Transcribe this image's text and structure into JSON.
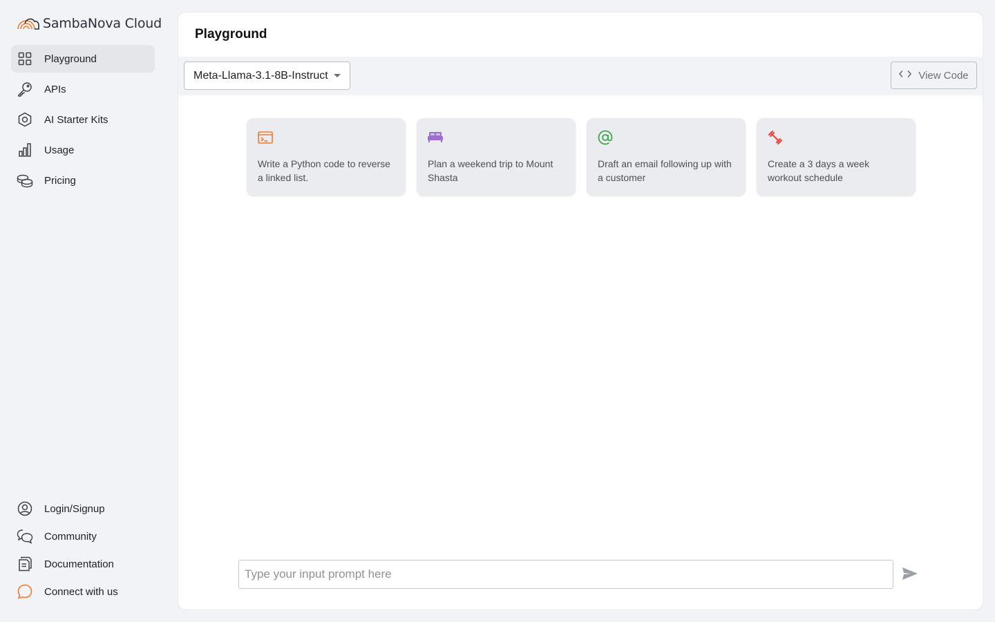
{
  "brand": {
    "name": "SambaNova Cloud",
    "accent": "#f07c32"
  },
  "sidebar": {
    "items": [
      {
        "label": "Playground",
        "icon": "grid-icon",
        "active": true
      },
      {
        "label": "APIs",
        "icon": "key-icon"
      },
      {
        "label": "AI Starter Kits",
        "icon": "hexagon-icon"
      },
      {
        "label": "Usage",
        "icon": "bar-chart-icon"
      },
      {
        "label": "Pricing",
        "icon": "coins-icon"
      }
    ],
    "bottom_items": [
      {
        "label": "Login/Signup",
        "icon": "user-circle-icon"
      },
      {
        "label": "Community",
        "icon": "chat-bubbles-icon"
      },
      {
        "label": "Documentation",
        "icon": "document-icon"
      },
      {
        "label": "Connect with us",
        "icon": "speech-bubble-icon"
      }
    ]
  },
  "main": {
    "title": "Playground",
    "model_select": {
      "value": "Meta-Llama-3.1-8B-Instruct"
    },
    "view_code_label": "View Code",
    "cards": [
      {
        "text": "Write a Python code to reverse a linked list.",
        "icon": "terminal-icon",
        "color": "#ee7a2f"
      },
      {
        "text": "Plan a weekend trip to Mount Shasta",
        "icon": "bed-icon",
        "color": "#9a6fd0"
      },
      {
        "text": "Draft an email following up with a customer",
        "icon": "at-sign-icon",
        "color": "#3aa84a"
      },
      {
        "text": "Create a 3 days a week workout schedule",
        "icon": "dumbbell-icon",
        "color": "#e0483e"
      }
    ],
    "prompt": {
      "placeholder": "Type your input prompt here",
      "value": ""
    }
  }
}
